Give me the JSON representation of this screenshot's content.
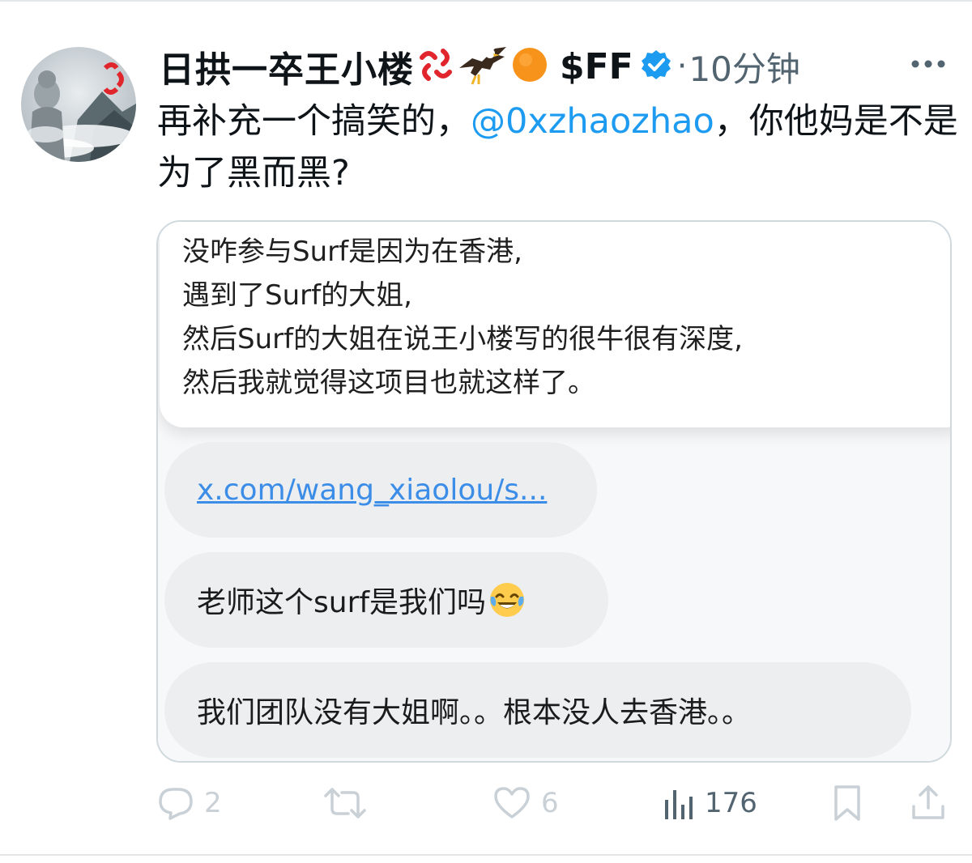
{
  "author": {
    "display_name": "日拱一卒王小楼",
    "badges": [
      "anger-symbol-icon",
      "eagle-icon",
      "orange-circle-icon"
    ],
    "ticker": "$FF",
    "verified": true,
    "separator": "·",
    "time": "10分钟"
  },
  "tweet": {
    "text_before": "再补充一个搞笑的，",
    "mention": "@0xzhaozhao",
    "text_after": "，你他妈是不是为了黑而黑?"
  },
  "media": {
    "quote_lines": [
      "没咋参与Surf是因为在香港,",
      "遇到了Surf的大姐,",
      "然后Surf的大姐在说王小楼写的很牛很有深度,",
      "然后我就觉得这项目也就这样了。"
    ],
    "link_text": "x.com/wang_xiaolou/s...",
    "message_2_text": "老师这个surf是我们吗",
    "message_2_emoji": "tears-of-joy-icon",
    "message_3": "我们团队没有大姐啊。。根本没人去香港。。"
  },
  "actions": {
    "replies": "2",
    "retweets": "",
    "likes": "6",
    "views": "176"
  },
  "colors": {
    "text": "#0f1419",
    "secondary": "#536471",
    "accent": "#1d9bf0",
    "verified": "#1d9bf0",
    "border": "#cfd9de",
    "bubble": "#eceef0",
    "link": "#3c8de8",
    "action_faded": "#c9d1d7"
  }
}
